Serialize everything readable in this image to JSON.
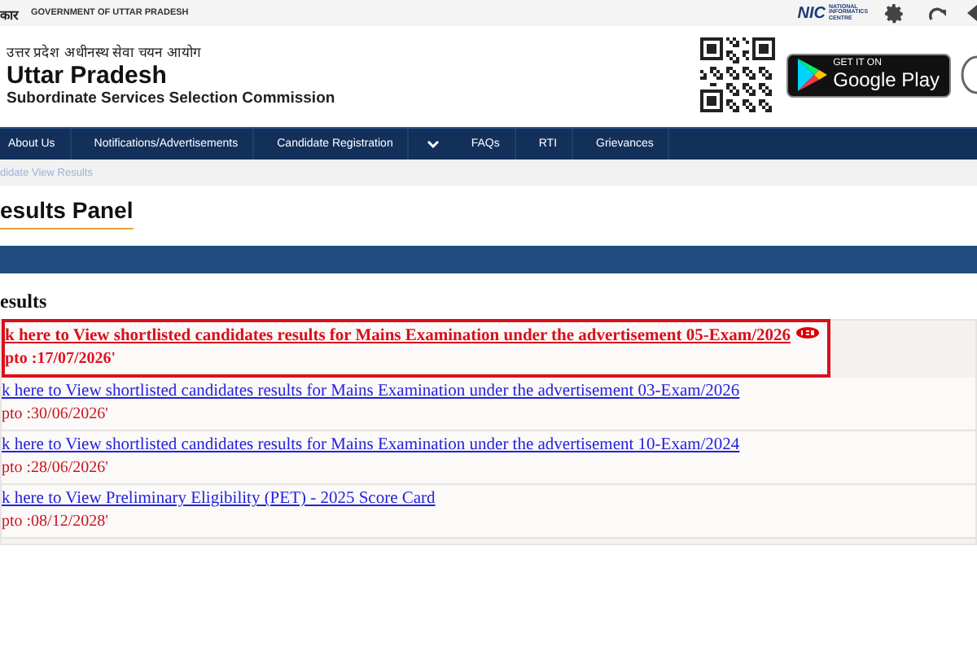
{
  "top_bar": {
    "gov_hindi": "कार",
    "gov_label": "GOVERNMENT OF UTTAR PRADESH",
    "nic_logo": "NIC",
    "nic_caption": "NATIONAL INFORMATICS CENTRE"
  },
  "header": {
    "hindi_name": "उत्तर प्रदेश अधीनस्थ सेवा चयन आयोग",
    "title": "Uttar Pradesh",
    "subtitle": "Subordinate Services Selection Commission",
    "play_badge": {
      "small": "GET IT ON",
      "big": "Google Play"
    }
  },
  "nav": [
    {
      "label": "About Us",
      "kind": "link"
    },
    {
      "label": "Notifications/Advertisements",
      "kind": "link"
    },
    {
      "label": "Candidate Registration",
      "kind": "link"
    },
    {
      "kind": "dropdown"
    },
    {
      "label": "FAQs",
      "kind": "link"
    },
    {
      "label": "RTI",
      "kind": "link"
    },
    {
      "label": "Grievances",
      "kind": "link"
    }
  ],
  "breadcrumb": "didate View Results",
  "page_title": "esults Panel",
  "section_title": "esults",
  "results": [
    {
      "link": "k here to View shortlisted candidates results for Mains Examination under the advertisement 05-Exam/2026",
      "date": "pto :17/07/2026'",
      "highlighted": true,
      "new": true
    },
    {
      "link": "k here to View shortlisted candidates results for Mains Examination under the advertisement 03-Exam/2026",
      "date": "pto :30/06/2026'",
      "highlighted": false,
      "new": false
    },
    {
      "link": "k here to View shortlisted candidates results for Mains Examination under the advertisement 10-Exam/2024",
      "date": "pto :28/06/2026'",
      "highlighted": false,
      "new": false
    },
    {
      "link": "k here to View Preliminary Eligibility (PET) - 2025 Score Card",
      "date": "pto :08/12/2028'",
      "highlighted": false,
      "new": false
    }
  ]
}
